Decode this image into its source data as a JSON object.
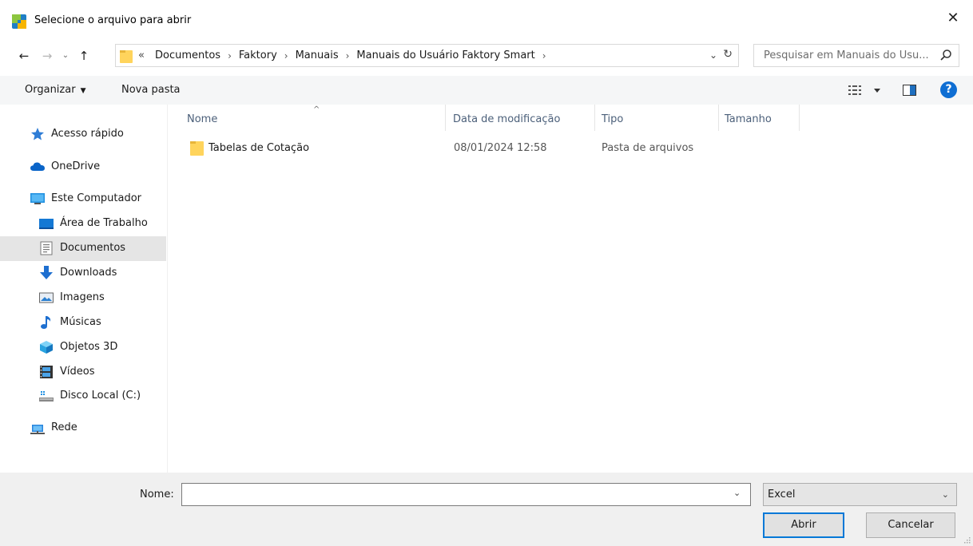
{
  "window": {
    "title": "Selecione o arquivo para abrir",
    "close_glyph": "✕"
  },
  "navigation": {
    "back_glyph": "←",
    "forward_glyph": "→",
    "recent_glyph": "⌄",
    "up_glyph": "↑",
    "overflow_glyph": "«",
    "breadcrumbs": [
      "Documentos",
      "Faktory",
      "Manuais",
      "Manuais do Usuário Faktory Smart"
    ],
    "separator": "›",
    "dropdown_glyph": "⌄",
    "refresh_glyph": "↻",
    "search_placeholder": "Pesquisar em Manuais do Usu..."
  },
  "toolbar": {
    "organizar_label": "Organizar",
    "organizar_arrow": "▼",
    "nova_pasta_label": "Nova pasta",
    "help_glyph": "?"
  },
  "sidebar": {
    "items": [
      {
        "label": "Acesso rápido",
        "icon": "star-icon"
      },
      {
        "label": "OneDrive",
        "icon": "cloud-icon"
      },
      {
        "label": "Este Computador",
        "icon": "computer-icon"
      },
      {
        "label": "Área de Trabalho",
        "icon": "desktop-icon"
      },
      {
        "label": "Documentos",
        "icon": "documents-icon",
        "selected": true
      },
      {
        "label": "Downloads",
        "icon": "download-icon"
      },
      {
        "label": "Imagens",
        "icon": "pictures-icon"
      },
      {
        "label": "Músicas",
        "icon": "music-icon"
      },
      {
        "label": "Objetos 3D",
        "icon": "3d-objects-icon"
      },
      {
        "label": "Vídeos",
        "icon": "videos-icon"
      },
      {
        "label": "Disco Local (C:)",
        "icon": "drive-icon"
      },
      {
        "label": "Rede",
        "icon": "network-icon"
      }
    ]
  },
  "file_list": {
    "columns": [
      "Nome",
      "Data de modificação",
      "Tipo",
      "Tamanho"
    ],
    "sort_caret": "^",
    "rows": [
      {
        "name": "Tabelas de Cotação",
        "modified": "08/01/2024 12:58",
        "type": "Pasta de arquivos",
        "size": ""
      }
    ]
  },
  "footer": {
    "name_label": "Nome:",
    "name_value": "",
    "name_dropdown_glyph": "⌄",
    "file_type": "Excel",
    "file_type_dropdown_glyph": "⌄",
    "open_label": "Abrir",
    "cancel_label": "Cancelar"
  },
  "colors": {
    "accent": "#0078d7",
    "toolbar_bg": "#f5f6f7",
    "footer_bg": "#f0f0f0",
    "selected_bg": "#e5e5e5",
    "column_header_text": "#4c607a",
    "folder_yellow": "#ffd45c"
  }
}
